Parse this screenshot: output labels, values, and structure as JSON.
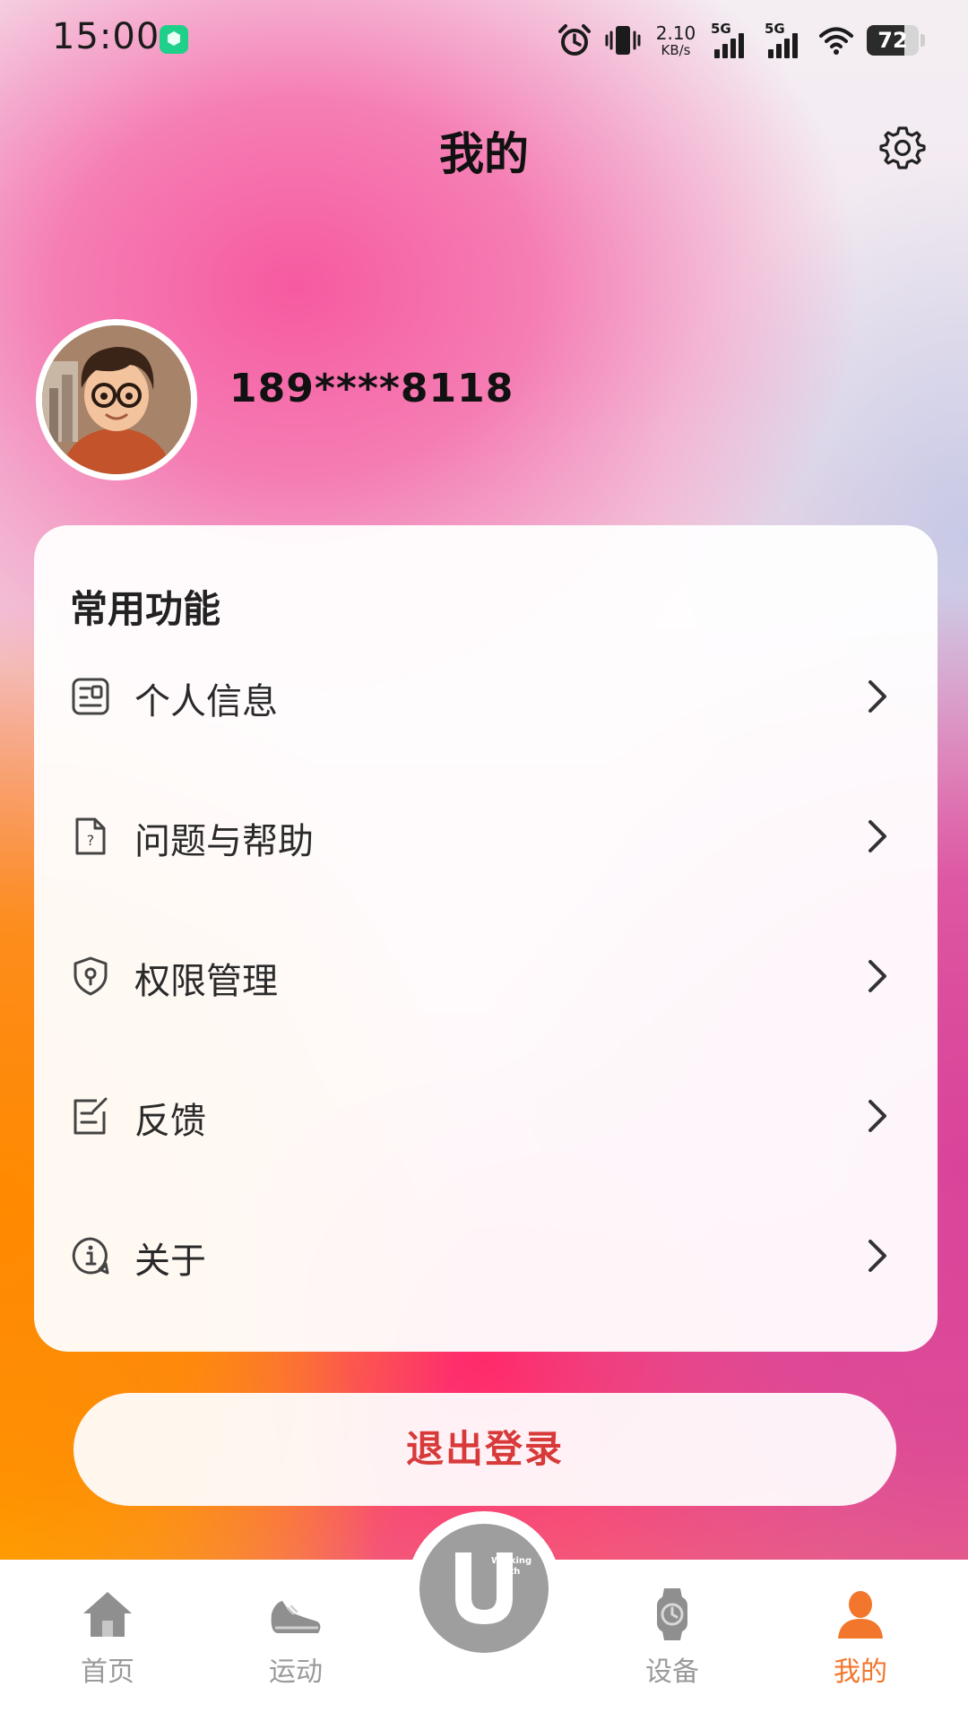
{
  "status_bar": {
    "time": "15:00",
    "net_speed_value": "2.10",
    "net_speed_unit": "KB/s",
    "signal_1_label": "5G",
    "signal_2_label": "5G",
    "battery_level": "72",
    "icons": [
      "app-badge-icon",
      "alarm-icon",
      "vibrate-icon",
      "wifi-icon",
      "battery-icon"
    ]
  },
  "header": {
    "title": "我的",
    "settings_icon": "gear-icon"
  },
  "profile": {
    "username": "189****8118",
    "avatar": "avatar"
  },
  "card": {
    "title": "常用功能",
    "items": [
      {
        "label": "个人信息",
        "icon": "id-card-icon"
      },
      {
        "label": "问题与帮助",
        "icon": "help-document-icon"
      },
      {
        "label": "权限管理",
        "icon": "shield-icon"
      },
      {
        "label": "反馈",
        "icon": "feedback-edit-icon"
      },
      {
        "label": "关于",
        "icon": "info-icon"
      }
    ]
  },
  "logout_label": "退出登录",
  "bottom_nav": {
    "items": [
      {
        "label": "首页",
        "icon": "home-icon"
      },
      {
        "label": "运动",
        "icon": "shoe-icon"
      },
      {
        "label": "设备",
        "icon": "watch-icon"
      },
      {
        "label": "我的",
        "icon": "person-icon",
        "active": true
      }
    ],
    "center_logo_text": "Walking With",
    "active_color": "#f2762b"
  },
  "colors": {
    "logout_text": "#d83a3a",
    "nav_inactive": "#9a9a9a"
  }
}
